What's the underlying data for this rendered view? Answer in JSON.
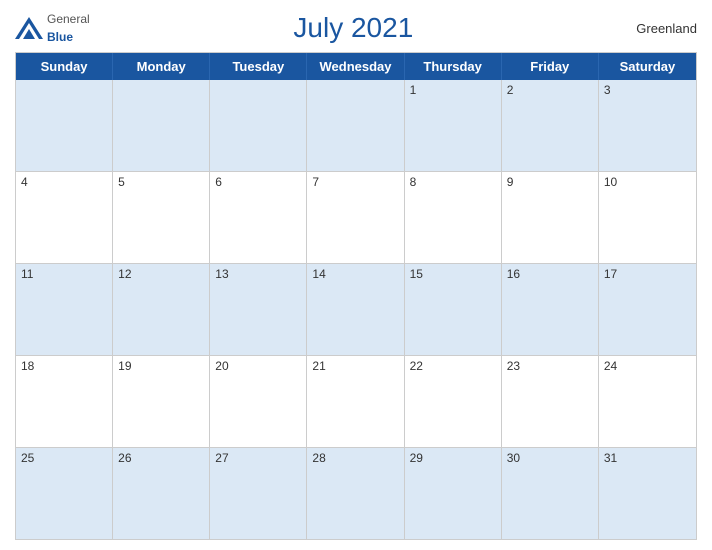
{
  "header": {
    "logo_general": "General",
    "logo_blue": "Blue",
    "title": "July 2021",
    "region": "Greenland"
  },
  "days_of_week": [
    "Sunday",
    "Monday",
    "Tuesday",
    "Wednesday",
    "Thursday",
    "Friday",
    "Saturday"
  ],
  "weeks": [
    [
      {
        "day": "",
        "empty": true
      },
      {
        "day": "",
        "empty": true
      },
      {
        "day": "",
        "empty": true
      },
      {
        "day": "",
        "empty": true
      },
      {
        "day": "1"
      },
      {
        "day": "2"
      },
      {
        "day": "3"
      }
    ],
    [
      {
        "day": "4"
      },
      {
        "day": "5"
      },
      {
        "day": "6"
      },
      {
        "day": "7"
      },
      {
        "day": "8"
      },
      {
        "day": "9"
      },
      {
        "day": "10"
      }
    ],
    [
      {
        "day": "11"
      },
      {
        "day": "12"
      },
      {
        "day": "13"
      },
      {
        "day": "14"
      },
      {
        "day": "15"
      },
      {
        "day": "16"
      },
      {
        "day": "17"
      }
    ],
    [
      {
        "day": "18"
      },
      {
        "day": "19"
      },
      {
        "day": "20"
      },
      {
        "day": "21"
      },
      {
        "day": "22"
      },
      {
        "day": "23"
      },
      {
        "day": "24"
      }
    ],
    [
      {
        "day": "25"
      },
      {
        "day": "26"
      },
      {
        "day": "27"
      },
      {
        "day": "28"
      },
      {
        "day": "29"
      },
      {
        "day": "30"
      },
      {
        "day": "31"
      }
    ]
  ]
}
